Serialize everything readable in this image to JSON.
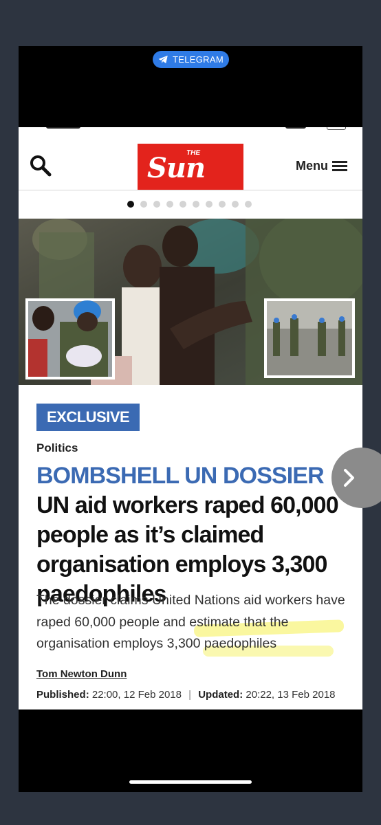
{
  "overlay": {
    "telegram_label": "TELEGRAM"
  },
  "header": {
    "logo_small": "THE",
    "logo_main": "Sun",
    "menu_label": "Menu"
  },
  "carousel": {
    "dot_count": 10,
    "active_index": 0
  },
  "article": {
    "badge": "EXCLUSIVE",
    "section": "Politics",
    "headline_kicker": "BOMBSHELL UN DOSSIER",
    "headline_rest": "UN aid workers raped 60,000 people as it’s claimed organisation employs 3,300 paedophiles",
    "standfirst": "The dossier claims United Nations aid workers have raped 60,000 people and estimate that the organisation employs 3,300 paedophiles",
    "author": "Tom Newton Dunn",
    "published_label": "Published",
    "published_value": "22:00, 12 Feb 2018",
    "updated_label": "Updated",
    "updated_value": "20:22, 13 Feb 2018"
  },
  "colors": {
    "brand_red": "#e3231c",
    "accent_blue": "#3b6ab3",
    "telegram_blue": "#2f7be6",
    "highlighter": "#f5f050"
  }
}
